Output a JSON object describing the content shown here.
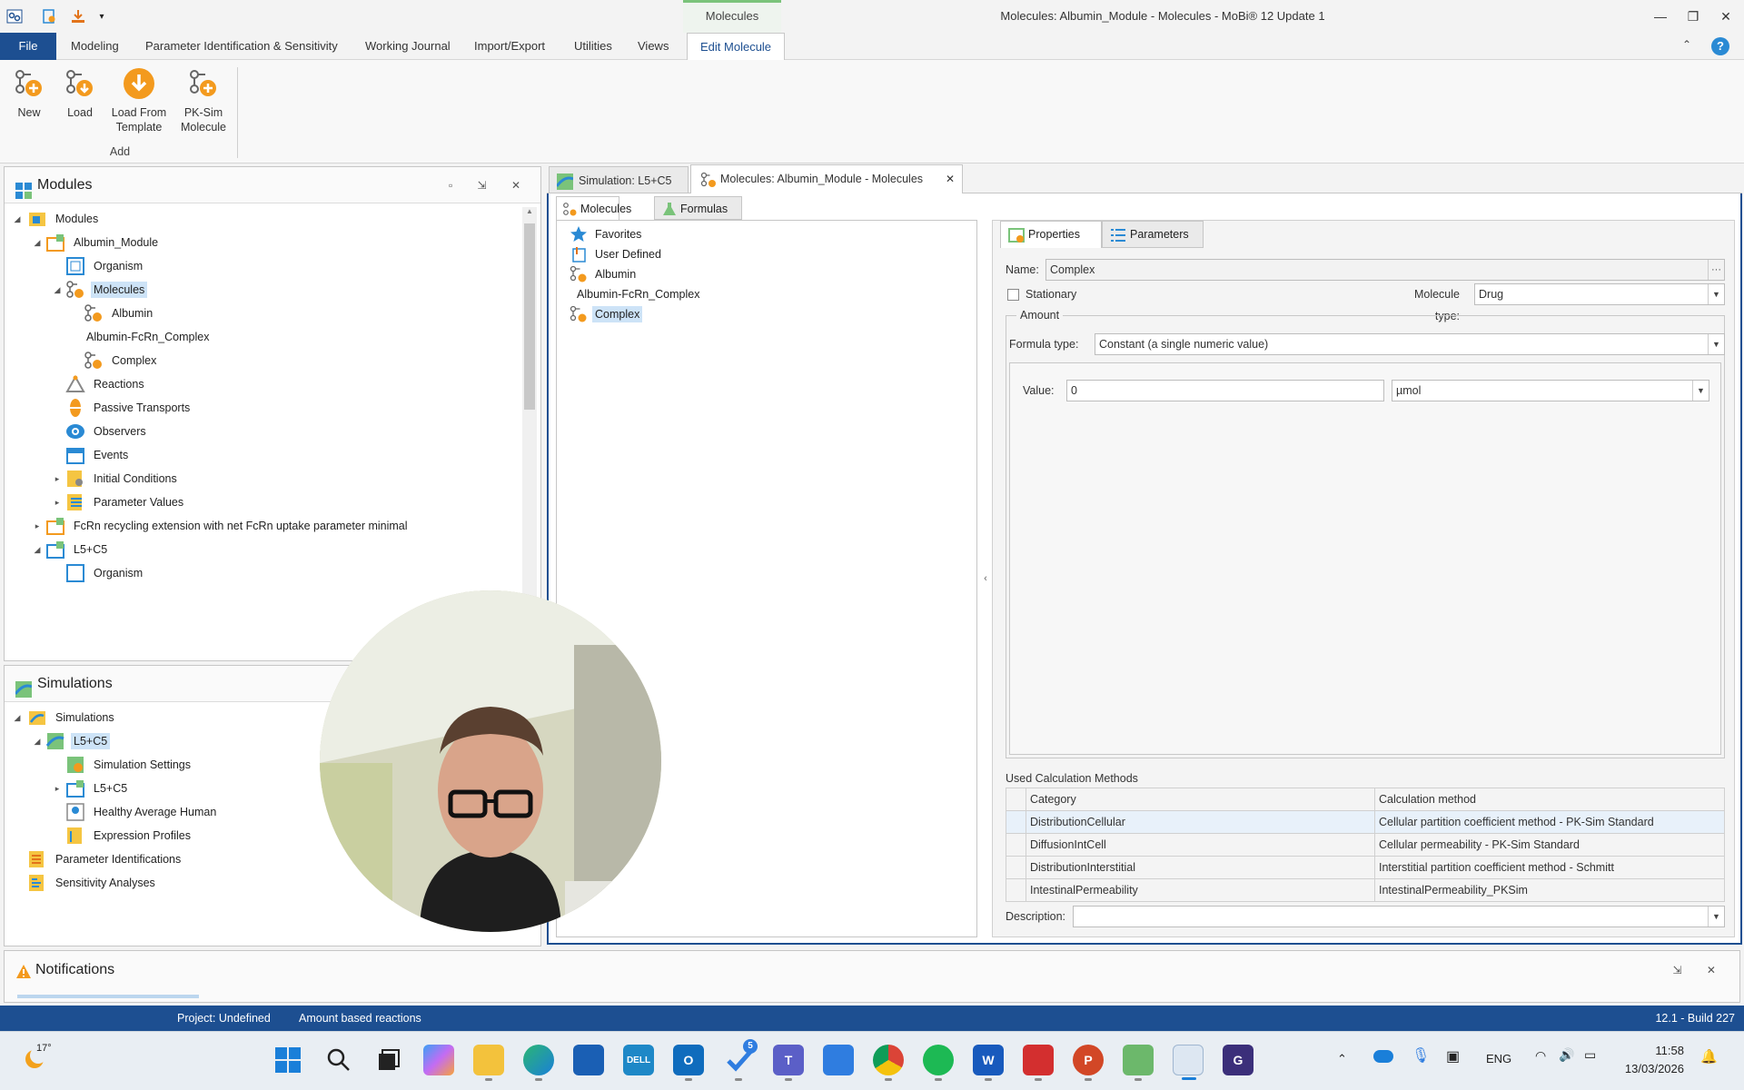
{
  "window": {
    "title": "Molecules: Albumin_Module - Molecules - MoBi® 12 Update 1",
    "context_tab": "Molecules"
  },
  "menu": {
    "file": "File",
    "items": [
      "Modeling",
      "Parameter Identification & Sensitivity",
      "Working Journal",
      "Import/Export",
      "Utilities",
      "Views"
    ],
    "active": "Edit Molecule"
  },
  "ribbon": {
    "buttons": [
      {
        "line1": "New",
        "line2": ""
      },
      {
        "line1": "Load",
        "line2": ""
      },
      {
        "line1": "Load From",
        "line2": "Template"
      },
      {
        "line1": "PK-Sim",
        "line2": "Molecule"
      }
    ],
    "group_label": "Add"
  },
  "modules_panel": {
    "title": "Modules",
    "tree": [
      {
        "label": "Modules",
        "icon": "folder-icon"
      },
      {
        "label": "Albumin_Module",
        "icon": "module-icon"
      },
      {
        "label": "Organism",
        "icon": "organism-icon"
      },
      {
        "label": "Molecules",
        "icon": "molecule-icon",
        "selected": true
      },
      {
        "label": "Albumin",
        "icon": "molecule-icon"
      },
      {
        "label": "Albumin-FcRn_Complex",
        "icon": ""
      },
      {
        "label": "Complex",
        "icon": "molecule-icon"
      },
      {
        "label": "Reactions",
        "icon": "reaction-icon"
      },
      {
        "label": "Passive Transports",
        "icon": "transport-icon"
      },
      {
        "label": "Observers",
        "icon": "observer-icon"
      },
      {
        "label": "Events",
        "icon": "calendar-icon"
      },
      {
        "label": "Initial Conditions",
        "icon": "initial-conditions-icon"
      },
      {
        "label": "Parameter Values",
        "icon": "parameter-values-icon"
      },
      {
        "label": "FcRn recycling extension with net FcRn uptake parameter minimal",
        "icon": "module-icon"
      },
      {
        "label": "L5+C5",
        "icon": "module-icon"
      },
      {
        "label": "Organism",
        "icon": "organism-icon"
      }
    ]
  },
  "simulations_panel": {
    "title": "Simulations",
    "tree": [
      {
        "label": "Simulations",
        "icon": "folder-icon"
      },
      {
        "label": "L5+C5",
        "icon": "simulation-icon",
        "selected": true
      },
      {
        "label": "Simulation Settings",
        "icon": "settings-icon"
      },
      {
        "label": "L5+C5",
        "icon": "module-icon"
      },
      {
        "label": "Healthy Average Human",
        "icon": "individual-icon"
      },
      {
        "label": "Expression Profiles",
        "icon": "expression-icon"
      },
      {
        "label": "Parameter Identifications",
        "icon": "parameter-identification-icon"
      },
      {
        "label": "Sensitivity Analyses",
        "icon": "sensitivity-icon"
      }
    ]
  },
  "notifications": {
    "title": "Notifications"
  },
  "doc_tabs": [
    {
      "label": "Simulation: L5+C5",
      "icon": "simulation-icon"
    },
    {
      "label": "Molecules: Albumin_Module - Molecules",
      "icon": "molecule-icon"
    }
  ],
  "inner_tabs": [
    "Molecules",
    "Formulas"
  ],
  "molecule_list": [
    {
      "label": "Favorites",
      "icon": "star-icon"
    },
    {
      "label": "User Defined",
      "icon": "user-defined-icon"
    },
    {
      "label": "Albumin",
      "icon": "molecule-icon"
    },
    {
      "label": "Albumin-FcRn_Complex",
      "icon": ""
    },
    {
      "label": "Complex",
      "icon": "molecule-icon",
      "selected": true
    }
  ],
  "properties": {
    "tabs": [
      "Properties",
      "Parameters"
    ],
    "name_label": "Name:",
    "name_value": "Complex",
    "stationary_label": "Stationary",
    "molecule_type_label": "Molecule type:",
    "molecule_type_value": "Drug",
    "amount_group": "Amount",
    "formula_type_label": "Formula type:",
    "formula_type_value": "Constant (a single numeric value)",
    "value_label": "Value:",
    "value": "0",
    "unit": "µmol",
    "calc_methods_title": "Used Calculation Methods",
    "calc_columns": [
      "Category",
      "Calculation method"
    ],
    "calc_rows": [
      [
        "DistributionCellular",
        "Cellular partition coefficient method - PK-Sim Standard"
      ],
      [
        "DiffusionIntCell",
        "Cellular permeability - PK-Sim Standard"
      ],
      [
        "DistributionInterstitial",
        "Interstitial partition coefficient method - Schmitt"
      ],
      [
        "IntestinalPermeability",
        "IntestinalPermeability_PKSim"
      ]
    ],
    "description_label": "Description:"
  },
  "statusbar": {
    "project": "Project: Undefined",
    "mode": "Amount based reactions",
    "version": "12.1 - Build 227"
  },
  "taskbar": {
    "weather": "17°",
    "lang": "ENG",
    "time": "11:58",
    "date": "13/03/2026",
    "todo_badge": "5"
  },
  "colors": {
    "accent_blue": "#1d4f91",
    "selection": "#cde3f7",
    "orange_icon": "#f39a1e"
  }
}
